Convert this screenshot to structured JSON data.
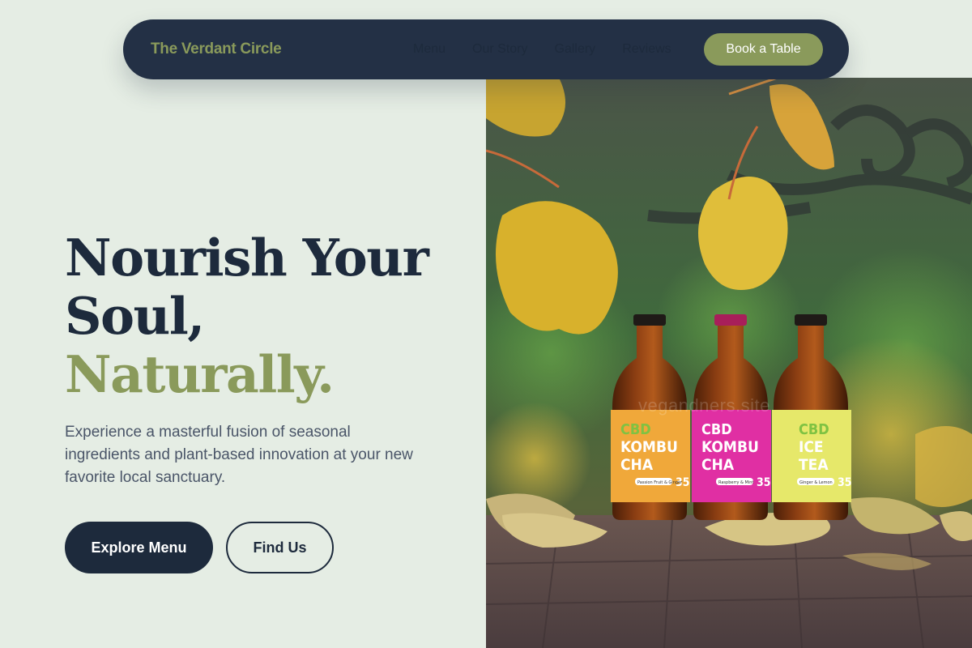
{
  "nav": {
    "brand": "The Verdant Circle",
    "links": [
      "Menu",
      "Our Story",
      "Gallery",
      "Reviews"
    ],
    "cta": "Book a Table"
  },
  "hero": {
    "title_line1": "Nourish Your",
    "title_line2": "Soul,",
    "title_accent": "Naturally.",
    "description": "Experience a masterful fusion of seasonal ingredients and plant-based innovation at your new favorite local sanctuary.",
    "primary_button": "Explore Menu",
    "secondary_button": "Find Us"
  },
  "image": {
    "watermark": "vegandners.site",
    "bottles": [
      {
        "brand": "CBD",
        "name_line1": "KOMBU",
        "name_line2": "CHA",
        "flavor": "Passion Fruit & Ginger",
        "number": "35",
        "label_color": "#f0a83a"
      },
      {
        "brand": "CBD",
        "name_line1": "KOMBU",
        "name_line2": "CHA",
        "flavor": "Raspberry & Mint",
        "number": "35",
        "label_color": "#e02fa3"
      },
      {
        "brand": "CBD",
        "name_line1": "ICE",
        "name_line2": "TEA",
        "flavor": "Ginger & Lemon",
        "number": "35",
        "label_color": "#e6e86a"
      }
    ]
  },
  "colors": {
    "navy": "#1d2a3c",
    "navbar": "#233045",
    "sage": "#8a9a5b",
    "background": "#e5ede4",
    "text_muted": "#4a5568"
  }
}
